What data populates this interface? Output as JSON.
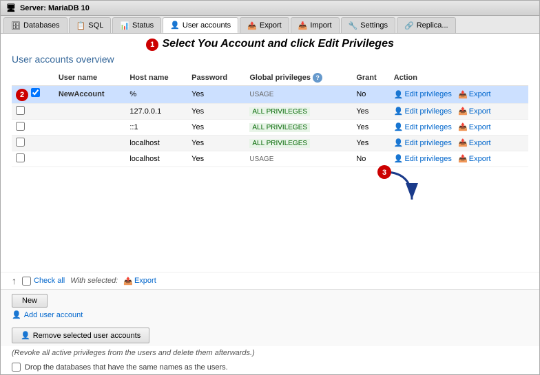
{
  "window": {
    "title": "Server: MariaDB 10"
  },
  "tabs": [
    {
      "id": "databases",
      "label": "Databases",
      "icon": "🗄",
      "active": false
    },
    {
      "id": "sql",
      "label": "SQL",
      "icon": "📋",
      "active": false
    },
    {
      "id": "status",
      "label": "Status",
      "icon": "📊",
      "active": false
    },
    {
      "id": "user-accounts",
      "label": "User accounts",
      "icon": "👤",
      "active": true
    },
    {
      "id": "export",
      "label": "Export",
      "icon": "📤",
      "active": false
    },
    {
      "id": "import",
      "label": "Import",
      "icon": "📥",
      "active": false
    },
    {
      "id": "settings",
      "label": "Settings",
      "icon": "🔧",
      "active": false
    },
    {
      "id": "replication",
      "label": "Replica...",
      "icon": "🔗",
      "active": false
    }
  ],
  "instruction": {
    "text": "Select You Account and click Edit Privileges",
    "step1_badge": "1",
    "step2_badge": "2",
    "step3_badge": "3"
  },
  "page": {
    "title": "User accounts overview"
  },
  "table": {
    "columns": [
      "",
      "User name",
      "Host name",
      "Password",
      "Global privileges",
      "",
      "Grant",
      "Action"
    ],
    "rows": [
      {
        "checkbox": true,
        "username": "NewAccount",
        "hostname": "%",
        "password": "Yes",
        "privileges": "USAGE",
        "privileges_type": "usage",
        "grant": "No",
        "highlighted": true
      },
      {
        "checkbox": false,
        "username": "",
        "hostname": "127.0.0.1",
        "password": "Yes",
        "privileges": "ALL PRIVILEGES",
        "privileges_type": "all",
        "grant": "Yes",
        "highlighted": false
      },
      {
        "checkbox": false,
        "username": "",
        "hostname": "::1",
        "password": "Yes",
        "privileges": "ALL PRIVILEGES",
        "privileges_type": "all",
        "grant": "Yes",
        "highlighted": false
      },
      {
        "checkbox": false,
        "username": "",
        "hostname": "localhost",
        "password": "Yes",
        "privileges": "ALL PRIVILEGES",
        "privileges_type": "all",
        "grant": "Yes",
        "highlighted": false
      },
      {
        "checkbox": false,
        "username": "",
        "hostname": "localhost",
        "password": "Yes",
        "privileges": "USAGE",
        "privileges_type": "usage",
        "grant": "No",
        "highlighted": false
      }
    ],
    "edit_label": "Edit privileges",
    "export_label": "Export"
  },
  "footer": {
    "check_all_label": "Check all",
    "with_selected_label": "With selected:",
    "export_label": "Export"
  },
  "new_section": {
    "button_label": "New",
    "add_account_label": "Add user account"
  },
  "remove_section": {
    "button_label": "Remove selected user accounts",
    "note_text": "(Revoke all active privileges from the users and delete them afterwards.)",
    "drop_db_label": "Drop the databases that have the same names as the users."
  },
  "colors": {
    "accent_blue": "#336699",
    "link_blue": "#0066cc",
    "badge_red": "#cc0000",
    "highlight_row": "#cce0ff"
  }
}
